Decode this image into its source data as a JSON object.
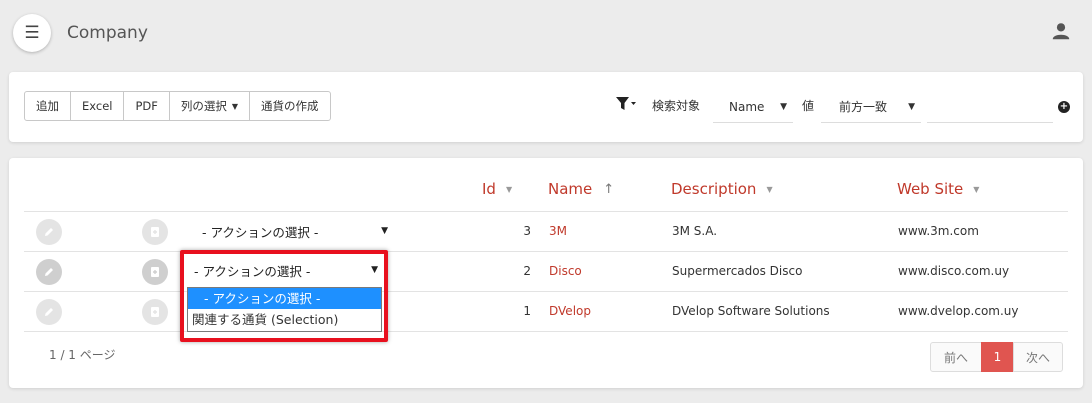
{
  "header": {
    "title": "Company",
    "menu_icon": "☰"
  },
  "toolbar": {
    "buttons": [
      "追加",
      "Excel",
      "PDF",
      "列の選択",
      "通貨の作成"
    ],
    "search_target_label": "検索対象",
    "field_value": "Name",
    "value_label": "値",
    "match_value": "前方一致",
    "search_value": ""
  },
  "table": {
    "columns": [
      "Id",
      "Name",
      "Description",
      "Web Site"
    ],
    "action_placeholder": "- アクションの選択 -",
    "rows": [
      {
        "id": "3",
        "name": "3M",
        "description": "3M S.A.",
        "website": "www.3m.com"
      },
      {
        "id": "2",
        "name": "Disco",
        "description": "Supermercados Disco",
        "website": "www.disco.com.uy"
      },
      {
        "id": "1",
        "name": "DVelop",
        "description": "DVelop Software Solutions",
        "website": "www.dvelop.com.uy"
      }
    ]
  },
  "dropdown": {
    "options": [
      "- アクションの選択 -",
      "関連する通貨 (Selection)"
    ],
    "selected": "- アクションの選択 -"
  },
  "pagination": {
    "info": "1 / 1 ページ",
    "prev": "前へ",
    "current": "1",
    "next": "次へ"
  },
  "colors": {
    "accent": "#c0392b",
    "current_page": "#e05550",
    "highlight": "#e8101e",
    "selected_option": "#1e90ff"
  },
  "icons": {
    "menu": "hamburger-icon",
    "user": "user-icon",
    "filter": "filter-icon",
    "add": "plus-circle-icon",
    "edit": "pencil-icon",
    "copy": "copy-icon"
  }
}
